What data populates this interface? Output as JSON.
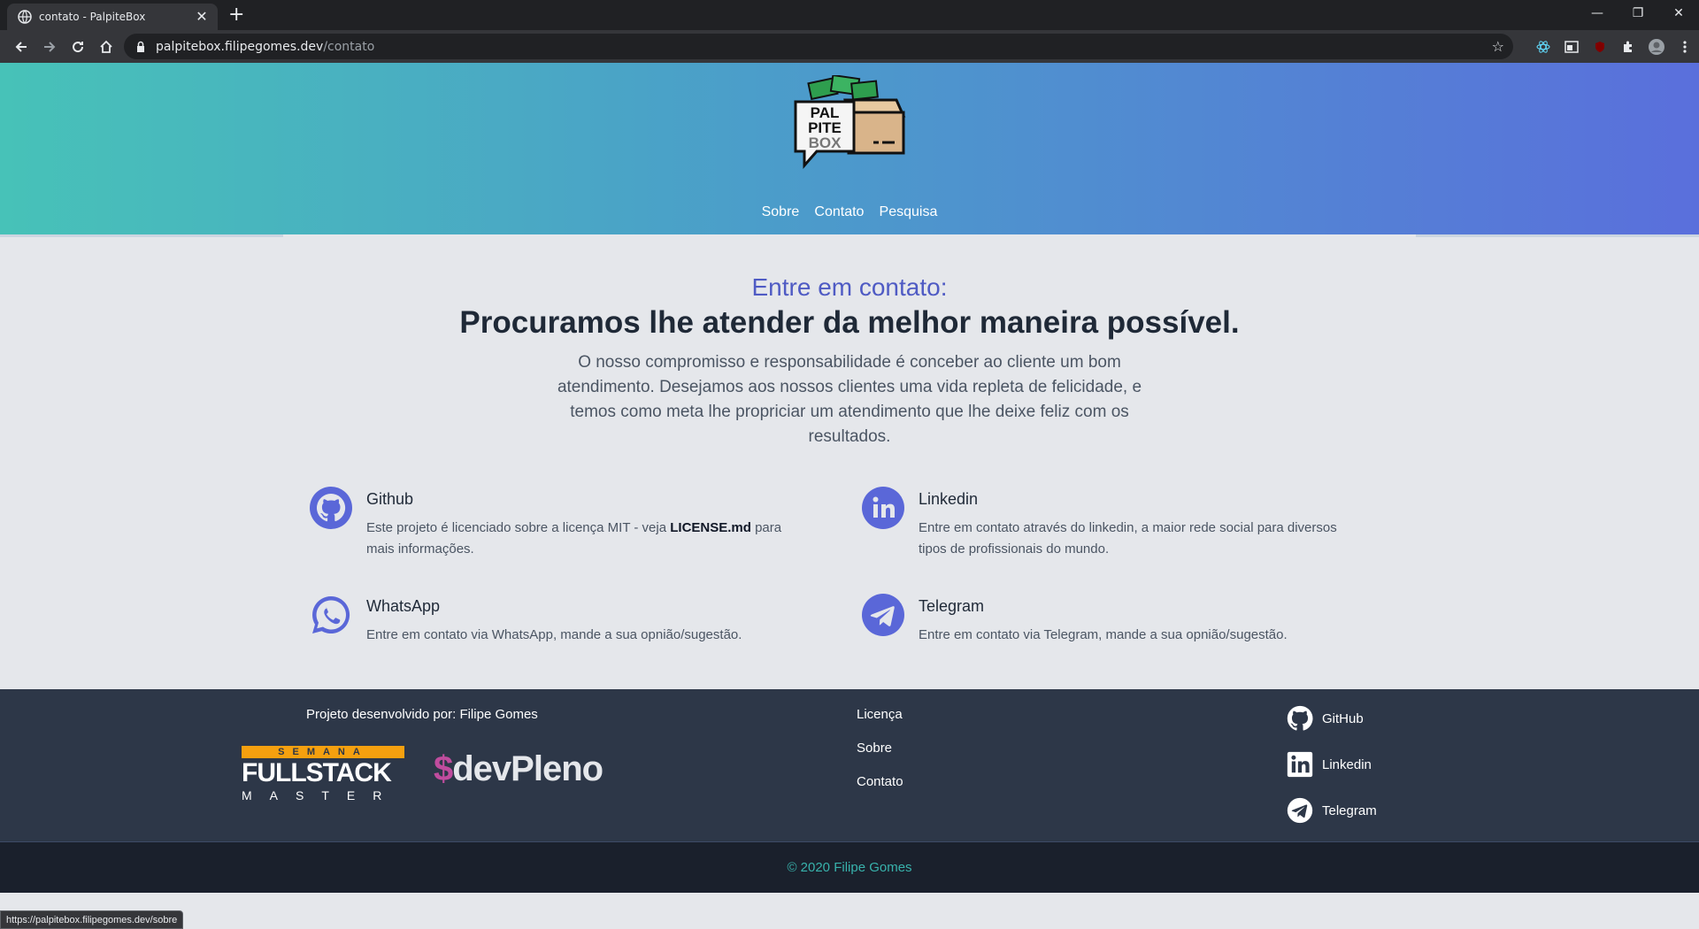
{
  "browser": {
    "tab_title": "contato - PalpiteBox",
    "url_host": "palpitebox.filipegomes.dev",
    "url_path": "/contato",
    "status_url": "https://palpitebox.filipegomes.dev/sobre"
  },
  "header": {
    "logo_text": [
      "PAL",
      "PITE",
      "BOX"
    ],
    "nav": [
      "Sobre",
      "Contato",
      "Pesquisa"
    ]
  },
  "main": {
    "subheading": "Entre em contato:",
    "heading": "Procuramos lhe atender da melhor maneira possível.",
    "intro": "O nosso compromisso e responsabilidade é conceber ao cliente um bom atendimento. Desejamos aos nossos clientes uma vida repleta de felicidade, e temos como meta lhe propriciar um atendimento que lhe deixe feliz com os resultados.",
    "cards": [
      {
        "title": "Github",
        "text_before": "Este projeto é licenciado sobre a licença MIT - veja ",
        "text_bold": "LICENSE.md",
        "text_after": " para mais informações.",
        "icon": "github-icon"
      },
      {
        "title": "Linkedin",
        "text": "Entre em contato através do linkedin, a maior rede social para diversos tipos de profissionais do mundo.",
        "icon": "linkedin-icon"
      },
      {
        "title": "WhatsApp",
        "text": "Entre em contato via WhatsApp, mande a sua opnião/sugestão.",
        "icon": "whatsapp-icon"
      },
      {
        "title": "Telegram",
        "text": "Entre em contato via Telegram, mande a sua opnião/sugestão.",
        "icon": "telegram-icon"
      }
    ]
  },
  "footer": {
    "credit": "Projeto desenvolvido por: Filipe Gomes",
    "fullstack_top": "SEMANA",
    "fullstack_main": "FULLSTACK",
    "fullstack_bottom": "MASTER",
    "devpleno_dollar": "$",
    "devpleno_text": "devPleno",
    "links": [
      "Licença",
      "Sobre",
      "Contato"
    ],
    "social": [
      "GitHub",
      "Linkedin",
      "Telegram"
    ],
    "copyright": "© 2020 Filipe Gomes"
  },
  "colors": {
    "accent": "#5a67d8",
    "header_gradient": [
      "#47c2b8",
      "#5a6fdc"
    ],
    "copyright": "#38b2ac"
  }
}
